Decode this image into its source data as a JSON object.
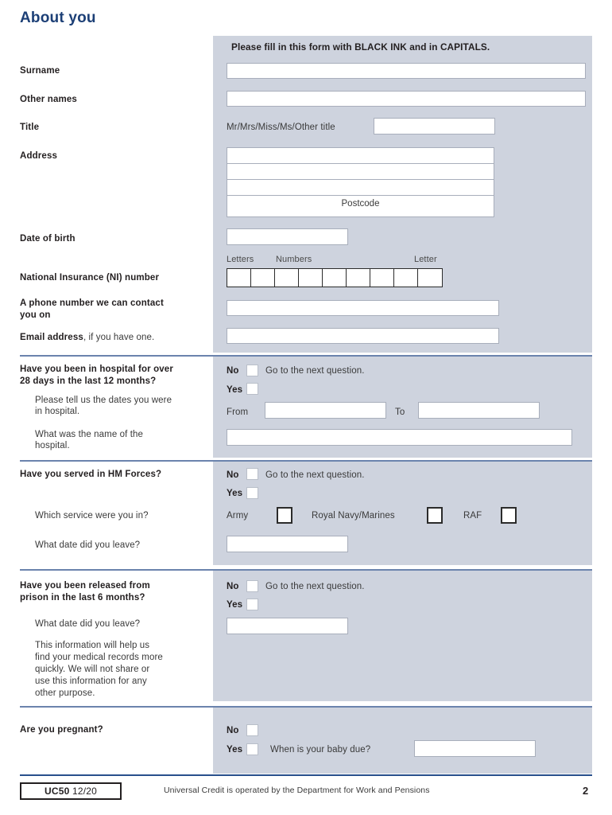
{
  "page": {
    "title": "About you",
    "number": "2"
  },
  "panel": {
    "instruction": "Please fill in this form with BLACK INK and in CAPITALS."
  },
  "identity": {
    "surname_label": "Surname",
    "other_names_label": "Other names",
    "title_label": "Title",
    "title_hint": "Mr/Mrs/Miss/Ms/Other title",
    "address_label": "Address",
    "postcode_label": "Postcode",
    "dob_label": "Date of birth",
    "ni_label": "National Insurance (NI) number",
    "ni_hint_letters": "Letters",
    "ni_hint_numbers": "Numbers",
    "ni_hint_letter": "Letter",
    "ni_cells": 9,
    "phone_label_line1": "A phone number we can contact",
    "phone_label_line2": "you on",
    "email_label_bold": "Email address",
    "email_label_rest": ", if you have one."
  },
  "common": {
    "no": "No",
    "yes": "Yes",
    "go_next": "Go to the next question."
  },
  "hospital": {
    "question_line1": "Have you been in hospital for over",
    "question_line2": "28 days in the last 12 months?",
    "sub1_line1": "Please tell us the dates you were",
    "sub1_line2": "in hospital.",
    "sub2_line1": "What was the name of the",
    "sub2_line2": "hospital.",
    "from_label": "From",
    "to_label": "To"
  },
  "forces": {
    "question": "Have you served in HM Forces?",
    "sub1": "Which service were you in?",
    "sub2": "What date did you leave?",
    "services": [
      "Army",
      "Royal Navy/Marines",
      "RAF"
    ]
  },
  "prison": {
    "question_line1": "Have you been released from",
    "question_line2": "prison in the last 6 months?",
    "sub1": "What date did you leave?",
    "note": [
      "This information will help us",
      "find your medical records more",
      "quickly. We will not share or",
      "use this information for any",
      "other purpose."
    ]
  },
  "pregnancy": {
    "question": "Are you pregnant?",
    "due_label": "When is your baby due?"
  },
  "footer": {
    "form_code": "UC50",
    "form_date": "12/20",
    "note": "Universal Credit is operated by the Department for Work and Pensions"
  },
  "colors": {
    "title_blue": "#1c3f76",
    "panel_grey": "#ced3de",
    "rule_blue": "#6b83ad",
    "footer_rule": "#29508c"
  }
}
